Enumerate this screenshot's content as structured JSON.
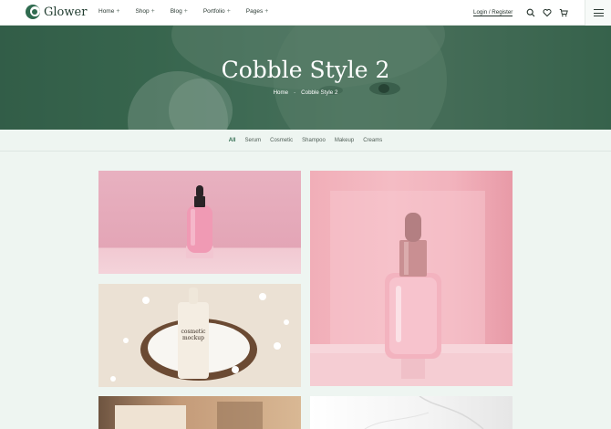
{
  "brand": {
    "name": "Glower"
  },
  "nav": [
    {
      "label": "Home"
    },
    {
      "label": "Shop"
    },
    {
      "label": "Blog"
    },
    {
      "label": "Portfolio"
    },
    {
      "label": "Pages"
    }
  ],
  "nav_expand_symbol": "+",
  "header": {
    "login_label": "Login / Register"
  },
  "hero": {
    "title": "Cobble Style 2"
  },
  "breadcrumb": {
    "home": "Home",
    "separator": "-",
    "current": "Cobble Style 2"
  },
  "filters": [
    {
      "label": "All"
    },
    {
      "label": "Serum"
    },
    {
      "label": "Cosmetic"
    },
    {
      "label": "Shampoo"
    },
    {
      "label": "Makeup"
    },
    {
      "label": "Creams"
    }
  ],
  "portfolio": {
    "mockup_label": "cosmetic mockup"
  },
  "colors": {
    "accent": "#2f6b4f",
    "hero_tint": "#3d6b53",
    "page_bg": "#eef5f1"
  }
}
